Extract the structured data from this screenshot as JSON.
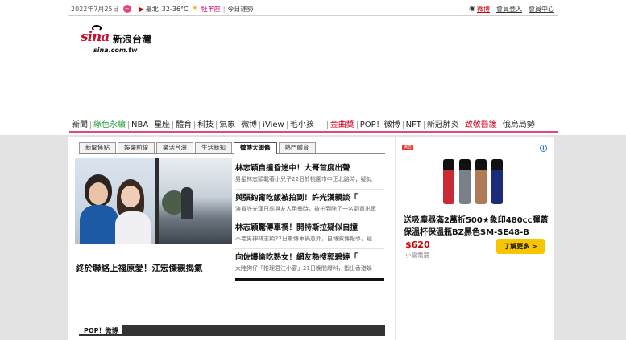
{
  "topbar": {
    "date": "2022年7月25日",
    "city": "臺北",
    "temperature": "32-36°C",
    "zodiac": "牡羊座",
    "separator": "|",
    "fortune": "今日運勢",
    "weibo": "微博",
    "login": "會員登入",
    "member_center": "會員中心"
  },
  "logo": {
    "brand": "sina",
    "chinese": "新浪台灣",
    "domain": "sina.com.tw"
  },
  "nav": {
    "items": [
      "新聞",
      "綠色永續",
      "NBA",
      "星座",
      "體育",
      "科技",
      "氣象",
      "微博",
      "iView",
      "毛小孩"
    ],
    "items2": [
      "金曲獎",
      "POP！微博",
      "NFT",
      "新冠肺炎",
      "致敬醫護",
      "俄烏局勢"
    ]
  },
  "subtabs": [
    "新聞焦點",
    "娛樂前線",
    "樂活台灣",
    "生活新知",
    "微博大頭條",
    "熱門體育"
  ],
  "active_subtab": "微博大頭條",
  "feature": {
    "caption": "終於聯絡上福原愛！江宏傑親揭氣"
  },
  "news": [
    {
      "head": "林志穎自撞昏迷中！大哥首度出聲",
      "snip": "男星林志穎載著小兒子22日於桃園市中正北路時，疑似"
    },
    {
      "head": "與張鈞甯吃飯被拍到！許光漢親談「",
      "snip": "演員許光漢日前與友人用餐時，被拍到除了一名氣質出眾"
    },
    {
      "head": "林志穎驚傳車禍！開特斯拉疑似自撞",
      "snip": "不老男神林志穎22日驚傳車禍意外，自傳微博報導，疑"
    },
    {
      "head": "向佐爆偷吃熟女！網友熱搜郭碧婷「",
      "snip": "大陸狗仔「推理君江小宴」21日晚間爆料，指出香港娛"
    }
  ],
  "pop": {
    "label": "POP！微博"
  },
  "ad": {
    "badge": "廣告",
    "title": "送吸塵器滿2萬折500★象印480cc彈蓋保溫杯保溫瓶BZ黑色SM-SE48-B",
    "price": "$620",
    "seller": "小嘉電器",
    "cta": "了解更多 >"
  },
  "icons": {
    "calendar": "calendar-icon",
    "location": "location-icon",
    "weather": "sun-cloud-icon",
    "weibo": "weibo-icon",
    "info": "info-icon"
  },
  "colors": {
    "accent": "#e4487b",
    "brand_red": "#c8102e",
    "green": "#2a9d3a",
    "cta": "#f7c600"
  }
}
